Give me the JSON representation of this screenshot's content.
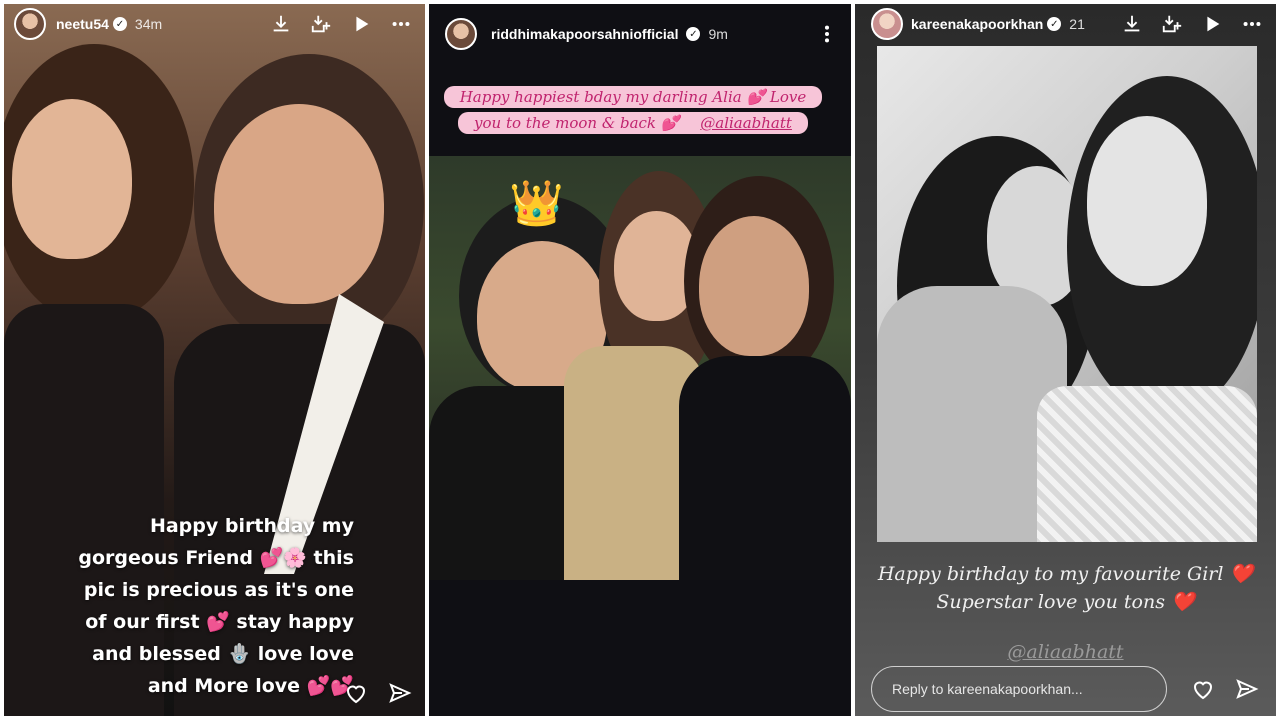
{
  "stories": [
    {
      "username": "neetu54",
      "time": "34m",
      "caption_lines": [
        "Happy birthday my",
        "gorgeous Friend 💕🌸 this",
        "pic is precious as it's one",
        "of our first 💕 stay happy",
        "and blessed 🪬 love  love",
        "and More love 💕💕"
      ]
    },
    {
      "username": "riddhimakapoorsahniofficial",
      "time": "9m",
      "caption_line1": "Happy happiest bday my darling Alia 💕 Love",
      "caption_line2": "you to the moon & back 💕",
      "mention": "@aliaabhatt",
      "sticker": "👑"
    },
    {
      "username": "kareenakapoorkhan",
      "time": "21",
      "caption_line1": "Happy birthday to my favourite Girl ❤️",
      "caption_line2": "Superstar love you tons ❤️",
      "mention": "@aliaabhatt",
      "reply_placeholder": "Reply to kareenakapoorkhan..."
    }
  ],
  "icons": [
    "download-icon",
    "add-to-icon",
    "play-icon",
    "more-icon",
    "heart-icon",
    "send-icon"
  ]
}
